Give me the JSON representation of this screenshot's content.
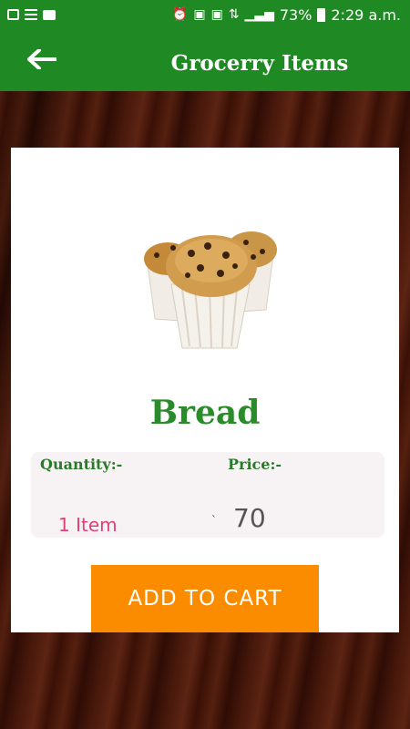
{
  "status_bar": {
    "battery": "73%",
    "time": "2:29 a.m.",
    "icons": [
      "image-icon",
      "list-icon",
      "chat-icon",
      "alarm-icon",
      "sim-icon",
      "sim-icon",
      "network-icon",
      "signal-icon",
      "battery-icon"
    ]
  },
  "toolbar": {
    "back_icon": "arrow-left-icon",
    "title": "Grocerry Items",
    "color": "#1f8a24"
  },
  "product": {
    "image": "muffins-image",
    "name": "Bread",
    "quantity_label": "Quantity:-",
    "quantity_value": "1 Item",
    "price_label": "Price:-",
    "price_prefix": "`",
    "price_value": "70"
  },
  "actions": {
    "add_to_cart": "ADD TO CART",
    "button_color": "#fb8c00"
  }
}
